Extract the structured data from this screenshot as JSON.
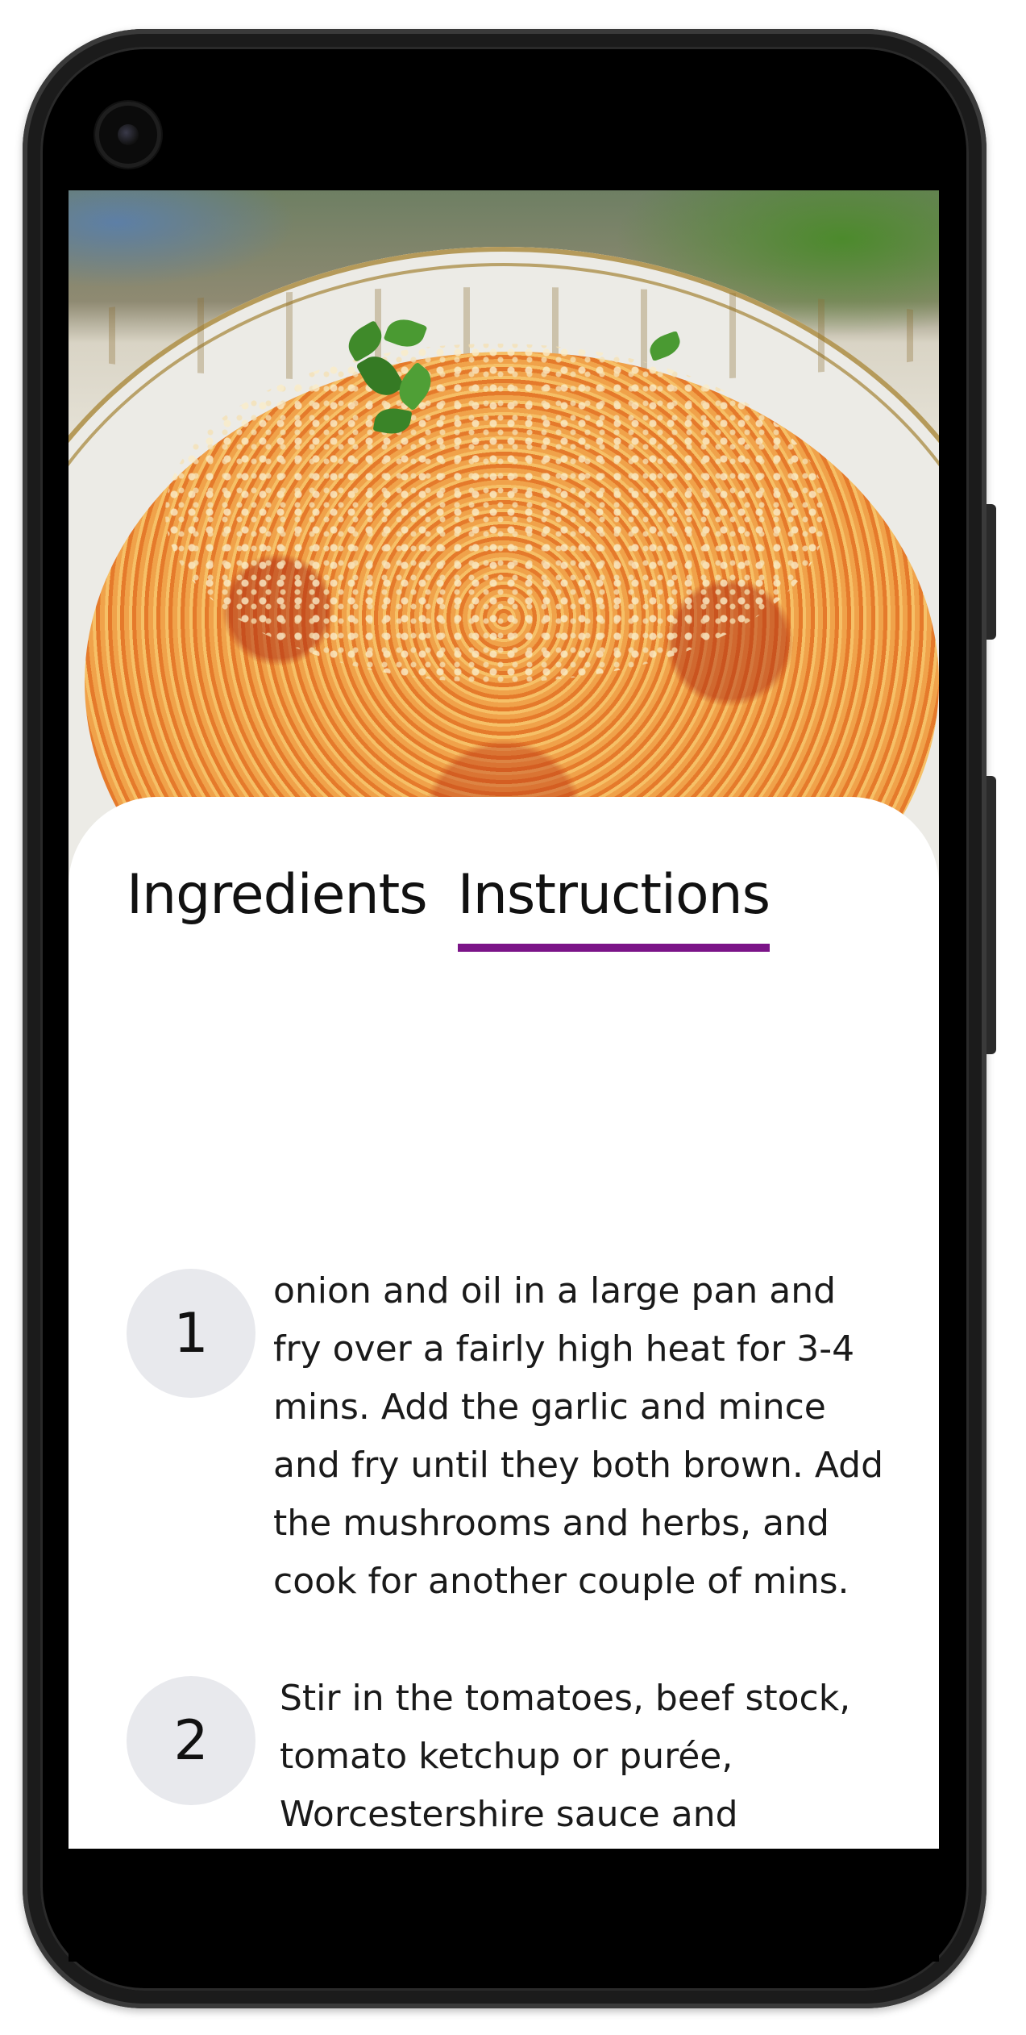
{
  "device": {
    "type": "android-phone",
    "frame_color": "#1b1b1b"
  },
  "hero": {
    "image": "spaghetti-bolognese-photo"
  },
  "tabs": [
    {
      "label": "Ingredients",
      "active": false
    },
    {
      "label": "Instructions",
      "active": true
    }
  ],
  "accent_color": "#7b1488",
  "steps": [
    {
      "number": "1",
      "text": "onion and oil in a large pan and fry over a fairly high heat for 3-4 mins. Add the garlic and mince and fry until they both brown. Add the mushrooms and herbs, and cook for another couple of mins."
    },
    {
      "number": "2",
      "text": "Stir in the tomatoes, beef stock, tomato ketchup or purée, Worcestershire sauce and seasoning. Bring to the boil, then reduce the heat, cover and simmer, stirring occasionally, for"
    }
  ]
}
